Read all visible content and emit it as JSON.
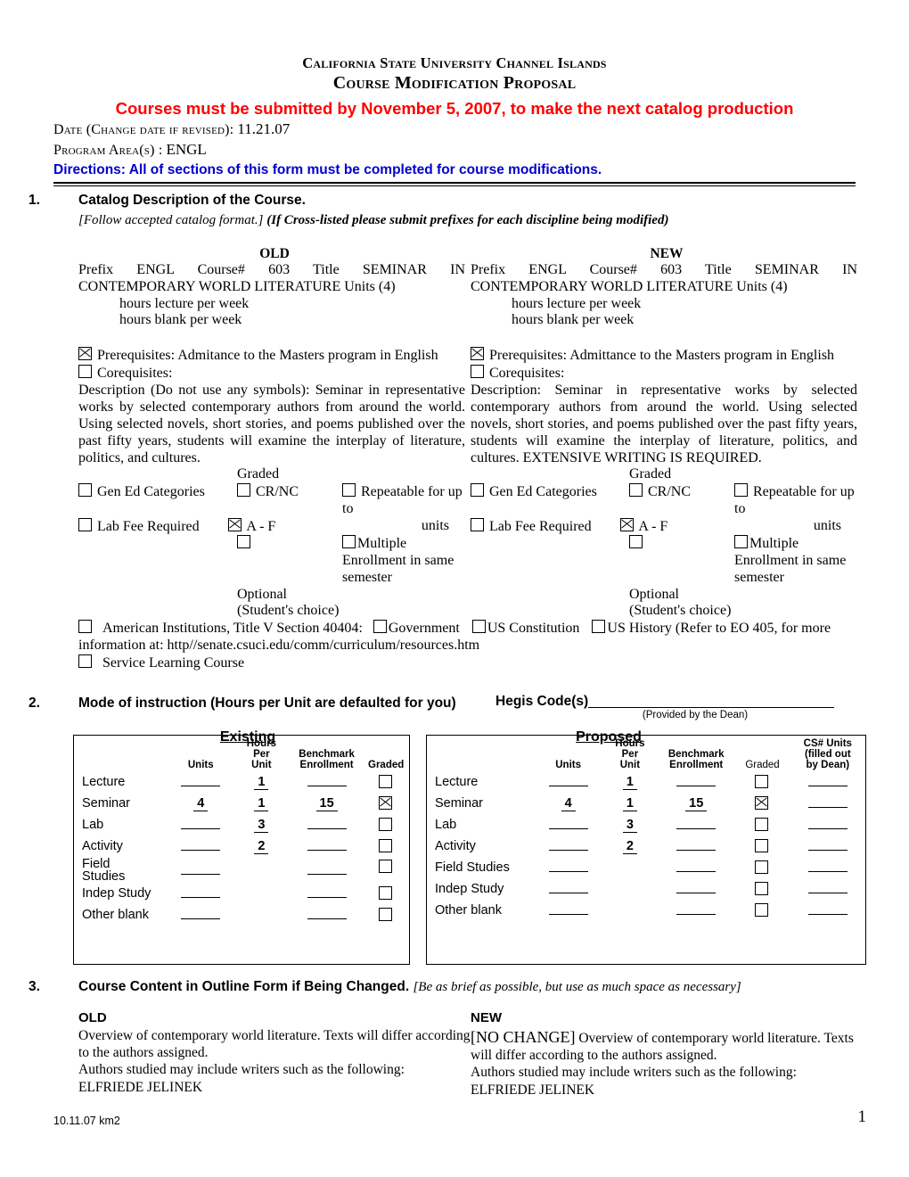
{
  "header": {
    "university": "California State University Channel Islands",
    "proposal_title": "Course Modification Proposal",
    "deadline_notice": "Courses must be submitted by November 5, 2007, to make the next catalog production",
    "date_label": "Date (Change date if revised):",
    "date_value": "11.21.07",
    "program_label": "Program Area(s) :",
    "program_value": "ENGL",
    "directions": "Directions:  All of sections of this form must be completed for course modifications.",
    "deadline_color": "#ff0000",
    "directions_color": "#0000cc"
  },
  "section1": {
    "number": "1.",
    "title": "Catalog Description of the Course.",
    "subtitle_italic": "[Follow accepted catalog format.] ",
    "subtitle_bold": "(If Cross-listed please submit prefixes for each discipline being modified)",
    "old_label": "OLD",
    "new_label": "NEW",
    "old": {
      "line1": "Prefix  ENGL     Course#  603     Title  SEMINAR  IN  CONTEMPORARY WORLD LITERATURE   Units (4)",
      "hours_lecture": "hours  lecture per week",
      "hours_blank": "hours  blank per week",
      "prereq_label": "Prerequisites:   Admitance to the Masters program in English",
      "prereq_checked": true,
      "coreq_label": "Corequisites:",
      "coreq_checked": false,
      "description": "Description (Do not use any symbols):   Seminar in representative works by selected contemporary authors from around the world. Using selected novels, short stories, and poems published over the past fifty years, students will examine the interplay of literature, politics, and cultures.",
      "graded_label": "Graded",
      "gen_ed": "Gen Ed Categories",
      "gen_ed_checked": false,
      "crnc": "CR/NC",
      "crnc_checked": false,
      "repeatable": "Repeatable for up to",
      "repeatable_checked": false,
      "units_word": "units",
      "lab_fee": "Lab Fee Required",
      "lab_fee_checked": false,
      "af": "A - F",
      "af_checked": true,
      "optional": "Optional (Student's choice)",
      "optional_checked": false,
      "multiple": "Multiple Enrollment in same semester",
      "multiple_checked": false
    },
    "new": {
      "line1": "Prefix  ENGL     Course#  603     Title  SEMINAR  IN  CONTEMPORARY WORLD LITERATURE  Units (4)",
      "hours_lecture": "hours  lecture per week",
      "hours_blank": "hours blank  per week",
      "prereq_label": "Prerequisites:   Admittance to the Masters program in English",
      "prereq_checked": true,
      "coreq_label": "Corequisites:",
      "coreq_checked": false,
      "description": "Description:   Seminar in representative works by selected contemporary authors from around the world. Using selected novels, short stories, and poems published over the past fifty years, students will examine the interplay of literature, politics, and cultures. EXTENSIVE WRITING IS REQUIRED.",
      "graded_label": "Graded",
      "gen_ed": "Gen Ed Categories",
      "gen_ed_checked": false,
      "crnc": "CR/NC",
      "crnc_checked": false,
      "repeatable": "Repeatable  for up to",
      "repeatable_checked": false,
      "units_word": "units",
      "lab_fee": "Lab Fee Required",
      "lab_fee_checked": false,
      "af": "A - F",
      "af_checked": true,
      "optional": "Optional (Student's choice)",
      "optional_checked": false,
      "multiple": "Multiple Enrollment in same semester",
      "multiple_checked": false
    },
    "american_institutions": {
      "checked": false,
      "text": "American Institutions, Title V Section 40404:",
      "government": "Government",
      "government_checked": false,
      "us_constitution": "US Constitution",
      "us_constitution_checked": false,
      "us_history": "US History (Refer to EO 405, for more information at:  http//senate.csuci.edu/comm/curriculum/resources.htm",
      "us_history_checked": false
    },
    "service_learning": "Service Learning Course",
    "service_learning_checked": false
  },
  "section2": {
    "number": "2.",
    "title": "Mode of instruction (Hours per Unit are defaulted for you)",
    "hegis_label": "Hegis Code(s)",
    "hegis_value": "",
    "hegis_note": "(Provided by the Dean)",
    "existing_label": "Existing",
    "proposed_label": "Proposed",
    "existing_table": {
      "columns": [
        "",
        "Units",
        "Hours Per Unit",
        "Benchmark Enrollment",
        "Graded"
      ],
      "col_units": "Units",
      "col_hours": "Hours\nPer\nUnit",
      "col_benchmark": "Benchmark\nEnrollment",
      "col_graded": "Graded",
      "rows": [
        {
          "label": "Lecture",
          "units": "",
          "hours": "1",
          "benchmark": "",
          "graded": false
        },
        {
          "label": "Seminar",
          "units": "4",
          "hours": "1",
          "benchmark": "15",
          "graded": true
        },
        {
          "label": "Lab",
          "units": "",
          "hours": "3",
          "benchmark": "",
          "graded": false
        },
        {
          "label": "Activity",
          "units": "",
          "hours": "2",
          "benchmark": "",
          "graded": false
        },
        {
          "label": "Field Studies",
          "units": "",
          "hours": "",
          "benchmark": "",
          "graded": false
        },
        {
          "label": "Indep Study",
          "units": "",
          "hours": "",
          "benchmark": "",
          "graded": false
        },
        {
          "label": "Other blank",
          "units": "",
          "hours": "",
          "benchmark": "",
          "graded": false
        }
      ]
    },
    "proposed_table": {
      "col_units": "Units",
      "col_hours": "Hours\nPer\nUnit",
      "col_benchmark": "Benchmark\nEnrollment",
      "col_graded": "Graded",
      "col_cs": "CS# Units\n(filled out\nby Dean)",
      "rows": [
        {
          "label": "Lecture",
          "units": "",
          "hours": "1",
          "benchmark": "",
          "graded": false,
          "cs": ""
        },
        {
          "label": "Seminar",
          "units": "4",
          "hours": "1",
          "benchmark": "15",
          "graded": true,
          "cs": ""
        },
        {
          "label": "Lab",
          "units": "",
          "hours": "3",
          "benchmark": "",
          "graded": false,
          "cs": ""
        },
        {
          "label": "Activity",
          "units": "",
          "hours": "2",
          "benchmark": "",
          "graded": false,
          "cs": ""
        },
        {
          "label": "Field Studies",
          "units": "",
          "hours": "",
          "benchmark": "",
          "graded": false,
          "cs": ""
        },
        {
          "label": "Indep Study",
          "units": "",
          "hours": "",
          "benchmark": "",
          "graded": false,
          "cs": ""
        },
        {
          "label": "Other blank",
          "units": "",
          "hours": "",
          "benchmark": "",
          "graded": false,
          "cs": ""
        }
      ]
    }
  },
  "section3": {
    "number": "3.",
    "title": "Course Content in Outline Form if Being Changed.",
    "subtitle_italic": "[Be as brief as possible, but use as much space as necessary]",
    "old_label": "OLD",
    "new_label": "NEW",
    "old_body_1": "Overview of contemporary world literature.  Texts will differ according to the authors assigned.",
    "old_body_2": "Authors studied may include writers such as the following:",
    "old_body_3": "ELFRIEDE JELINEK",
    "new_prefix": "[NO CHANGE]",
    "new_body_1": " Overview of contemporary world literature.  Texts will differ according to the authors assigned.",
    "new_body_2": "Authors studied may include writers such as the following:",
    "new_body_3": "ELFRIEDE JELINEK"
  },
  "footer": {
    "revision": "10.11.07 km2",
    "page_number": "1"
  }
}
